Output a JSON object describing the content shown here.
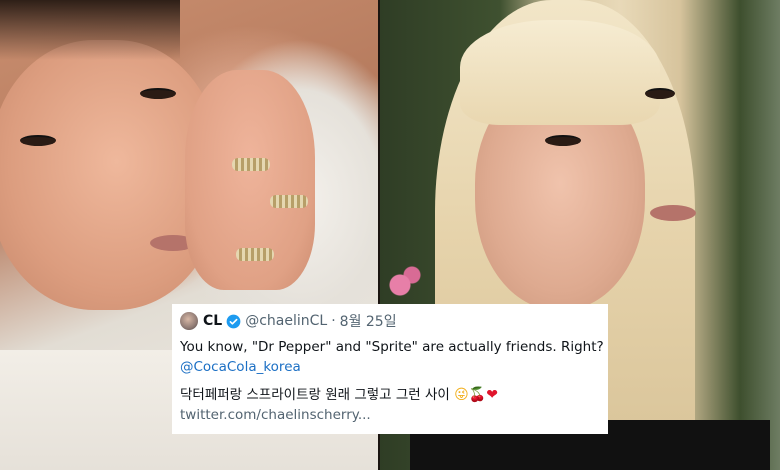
{
  "tweet": {
    "display_name": "CL",
    "handle": "@chaelinCL",
    "separator": "·",
    "date": "8월 25일",
    "line1": "You know, \"Dr Pepper\" and \"Sprite\" are actually friends. Right?",
    "mention": "@CocaCola_korea",
    "korean_text": "닥터페퍼랑 스프라이트랑 원래 그렇고 그런 사이",
    "emojis": [
      "😜",
      "🍒",
      "❤"
    ],
    "link": "twitter.com/chaelinscherry..."
  },
  "icons": {
    "avatar": "avatar",
    "verified": "verified-badge-icon"
  },
  "colors": {
    "verified_blue": "#1d9bf0",
    "mention_blue": "#1b6fc4",
    "secondary_text": "#536471"
  }
}
